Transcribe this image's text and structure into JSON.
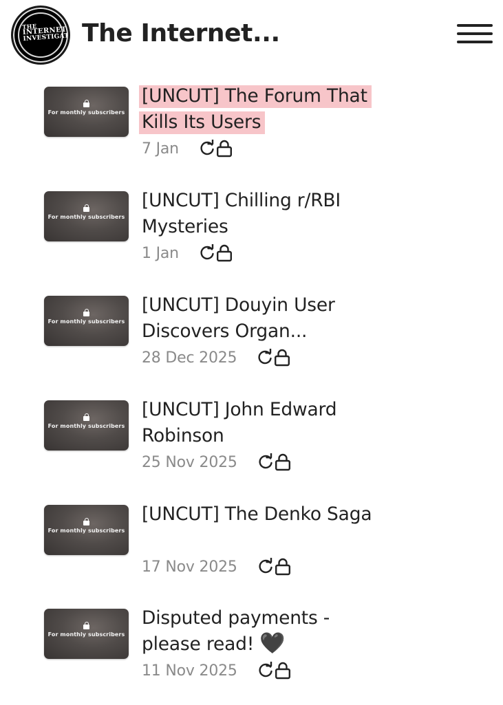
{
  "header": {
    "site_title": "The Internet...",
    "logo": {
      "line1": "THE",
      "line2": "INTERNET",
      "line3": "INVESTIGATOR"
    },
    "menu_icon": "hamburger-menu-icon"
  },
  "thumbnail_label": "For monthly subscribers",
  "icons": {
    "repost": "repost-icon",
    "lock": "lock-icon"
  },
  "colors": {
    "highlight": "#f7c5c9",
    "date_text": "#8a8a8a",
    "title_text": "#222222"
  },
  "posts": [
    {
      "title": "[UNCUT] The Forum That Kills Its Users",
      "date": "7 Jan",
      "highlighted": true
    },
    {
      "title": "[UNCUT] Chilling r/RBI Mysteries",
      "date": "1 Jan",
      "highlighted": false
    },
    {
      "title": "[UNCUT] Douyin User Discovers Organ...",
      "date": "28 Dec 2025",
      "highlighted": false
    },
    {
      "title": "[UNCUT] John Edward Robinson",
      "date": "25 Nov 2025",
      "highlighted": false
    },
    {
      "title": "[UNCUT] The Denko Saga",
      "date": "17 Nov 2025",
      "highlighted": false
    },
    {
      "title": "Disputed payments - please read!",
      "title_emoji": "🖤",
      "date": "11 Nov 2025",
      "highlighted": false
    }
  ]
}
